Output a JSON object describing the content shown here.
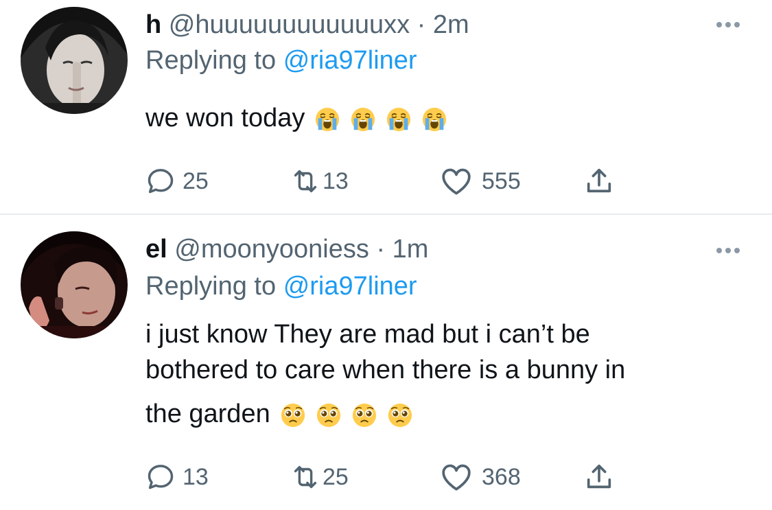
{
  "tweets": [
    {
      "name": "h",
      "handle": "@huuuuuuuuuuuuxx",
      "separator": "·",
      "time": "2m",
      "replying_prefix": "Replying to",
      "replying_to": "@ria97liner",
      "text": "we won today",
      "emoji": [
        "loudly-crying-face",
        "loudly-crying-face",
        "loudly-crying-face",
        "loudly-crying-face"
      ],
      "replies": "25",
      "retweets": "13",
      "likes": "555"
    },
    {
      "name": "el",
      "handle": "@moonyooniess",
      "separator": "·",
      "time": "1m",
      "replying_prefix": "Replying to",
      "replying_to": "@ria97liner",
      "text_line1": "i just know They are mad but i can’t be",
      "text_line2": "bothered to care when there is a bunny in",
      "text_line3": "the garden",
      "emoji": [
        "pleading-face",
        "pleading-face",
        "pleading-face",
        "pleading-face"
      ],
      "replies": "13",
      "retweets": "25",
      "likes": "368"
    }
  ],
  "colors": {
    "text": "#0f1419",
    "secondary": "#536471",
    "link": "#1d9bf0",
    "divider": "#e6ecf0"
  }
}
